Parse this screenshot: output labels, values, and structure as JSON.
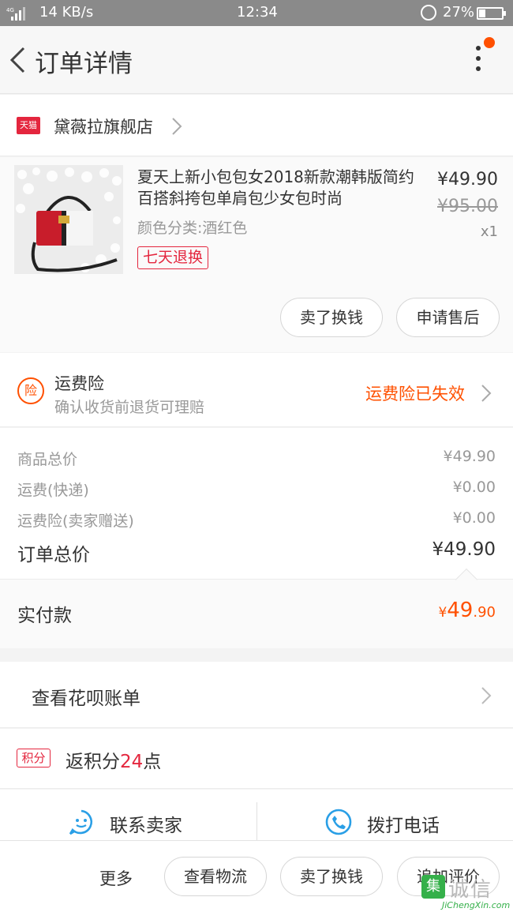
{
  "status_bar": {
    "signal": "4G",
    "net_speed": "14 KB/s",
    "time": "12:34",
    "battery": "27%"
  },
  "nav": {
    "title": "订单详情"
  },
  "store": {
    "badge": "天猫",
    "name": "黛薇拉旗舰店"
  },
  "product": {
    "title": "夏天上新小包包女2018新款潮韩版简约百搭斜挎包单肩包少女包时尚",
    "sku": "颜色分类:酒红色",
    "tag": "七天退换",
    "price": "¥49.90",
    "original_price": "¥95.00",
    "quantity": "x1",
    "buttons": [
      "卖了换钱",
      "申请售后"
    ]
  },
  "insurance": {
    "icon": "险",
    "title": "运费险",
    "subtitle": "确认收货前退货可理赔",
    "status": "运费险已失效"
  },
  "summary": {
    "rows": [
      {
        "label": "商品总价",
        "value": "¥49.90"
      },
      {
        "label": "运费(快递)",
        "value": "¥0.00"
      },
      {
        "label": "运费险(卖家赠送)",
        "value": "¥0.00"
      }
    ],
    "total_label": "订单总价",
    "total_value": "¥49.90"
  },
  "paid": {
    "label": "实付款",
    "currency": "¥",
    "integer": "49",
    "decimal": ".90"
  },
  "huabei": {
    "label": "查看花呗账单"
  },
  "points": {
    "badge": "积分",
    "prefix": "返积分",
    "amount": "24",
    "suffix": "点"
  },
  "contact": {
    "seller": "联系卖家",
    "phone": "拨打电话"
  },
  "bottom_bar": {
    "more": "更多",
    "buttons": [
      "查看物流",
      "卖了换钱",
      "追加评价"
    ]
  },
  "watermark": {
    "logo": "集",
    "text": "诚信",
    "url": "JiChengXin.com"
  },
  "colors": {
    "accent": "#ff5000",
    "tmall_red": "#e4263e",
    "contact_blue": "#2a9fe6",
    "watermark_green": "#35b04a"
  },
  "icons": {
    "back": "chevron-left-icon",
    "more": "more-vertical-icon",
    "store_arrow": "chevron-right-icon",
    "contact_seller": "chat-bubble-icon",
    "call": "phone-icon"
  }
}
